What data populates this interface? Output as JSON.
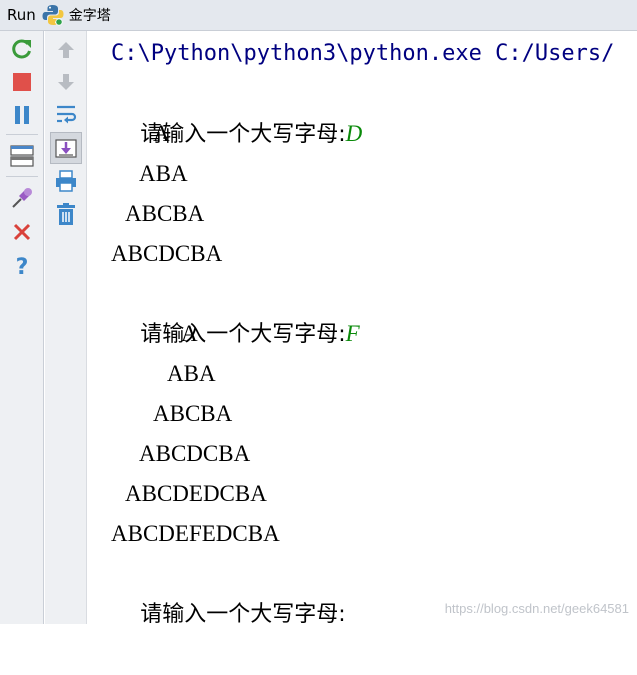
{
  "titlebar": {
    "run_label": "Run",
    "tab_title": "金字塔"
  },
  "toolbar_left": {
    "items": [
      {
        "name": "rerun-icon"
      },
      {
        "name": "stop-icon"
      },
      {
        "name": "pause-icon"
      },
      {
        "name": "layout-icon"
      },
      {
        "name": "pin-icon"
      },
      {
        "name": "close-icon"
      },
      {
        "name": "help-icon"
      }
    ]
  },
  "toolbar_mid": {
    "items": [
      {
        "name": "up-arrow-icon"
      },
      {
        "name": "down-arrow-icon"
      },
      {
        "name": "soft-wrap-icon"
      },
      {
        "name": "scroll-to-end-icon"
      },
      {
        "name": "print-icon"
      },
      {
        "name": "trash-icon"
      }
    ]
  },
  "console": {
    "command": "C:\\Python\\python3\\python.exe C:/Users/",
    "prompt": "请输入一个大写字母:",
    "input1": "D",
    "pyramid1": [
      "A",
      "ABA",
      "ABCBA",
      "ABCDCBA"
    ],
    "input2": "F",
    "pyramid2": [
      "A",
      "ABA",
      "ABCBA",
      "ABCDCBA",
      "ABCDEDCBA",
      "ABCDEFEDCBA"
    ]
  },
  "watermark": "https://blog.csdn.net/geek64581",
  "colors": {
    "command": "#000080",
    "user_input": "#0a8a0a",
    "toolbar_bg": "#eef0f3"
  }
}
